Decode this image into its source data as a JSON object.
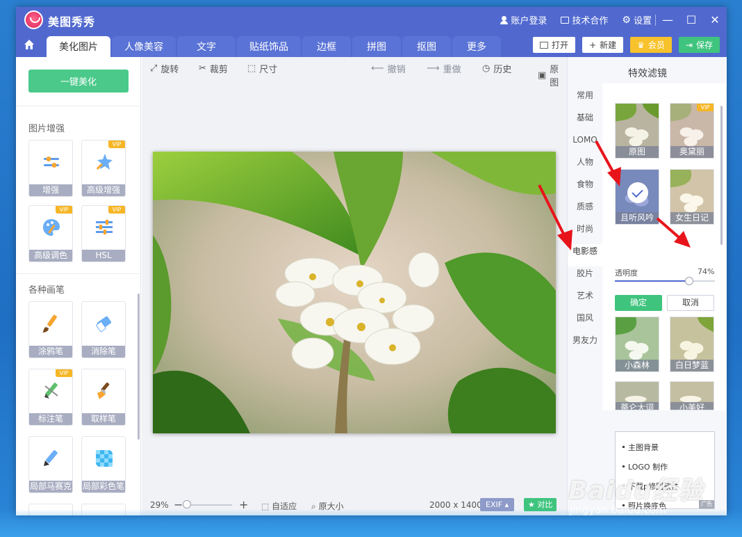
{
  "app": {
    "title": "美图秀秀",
    "account_login": "账户登录",
    "tech_coop": "技术合作",
    "settings": "设置"
  },
  "tabs": [
    {
      "label": "美化图片",
      "active": true
    },
    {
      "label": "人像美容"
    },
    {
      "label": "文字"
    },
    {
      "label": "贴纸饰品"
    },
    {
      "label": "边框"
    },
    {
      "label": "拼图"
    },
    {
      "label": "抠图"
    },
    {
      "label": "更多"
    }
  ],
  "top_buttons": {
    "open": "打开",
    "new": "新建",
    "vip": "会员",
    "save": "保存"
  },
  "left_panel": {
    "one_key": "一键美化",
    "section1_title": "图片增强",
    "section2_title": "各种画笔",
    "vip_badge": "VIP",
    "tools1": [
      {
        "label": "增强",
        "icon": "sliders-icon"
      },
      {
        "label": "高级增强",
        "icon": "magic-wand-icon"
      },
      {
        "label": "高级调色",
        "icon": "palette-icon"
      },
      {
        "label": "HSL",
        "icon": "hsl-sliders-icon"
      }
    ],
    "tools2": [
      {
        "label": "涂鸦笔",
        "icon": "brush-icon"
      },
      {
        "label": "消除笔",
        "icon": "eraser-icon"
      },
      {
        "label": "标注笔",
        "icon": "marker-icon"
      },
      {
        "label": "取样笔",
        "icon": "sample-brush-icon"
      },
      {
        "label": "局部马赛克",
        "icon": "mosaic-pen-icon"
      },
      {
        "label": "局部彩色笔",
        "icon": "color-pen-icon"
      }
    ]
  },
  "toolbar": {
    "rotate": "旋转",
    "crop": "裁剪",
    "size": "尺寸",
    "undo": "撤销",
    "redo": "重做",
    "history": "历史",
    "original": "原图"
  },
  "status": {
    "zoom": "29%",
    "fit": "自适应",
    "actual": "原大小",
    "dimensions": "2000 x 1400",
    "exif": "EXIF",
    "compare": "对比"
  },
  "right_panel": {
    "title": "特效滤镜",
    "categories": [
      "常用",
      "基础",
      "LOMO",
      "人物",
      "食物",
      "质感",
      "时尚",
      "电影感",
      "胶片",
      "艺术",
      "国风",
      "男友力"
    ],
    "active_category": "电影感",
    "filters": [
      {
        "label": "原图"
      },
      {
        "label": "奥黛丽",
        "vip": true
      },
      {
        "label": "且听风吟",
        "selected": true
      },
      {
        "label": "女生日记"
      },
      {
        "label": "小森林"
      },
      {
        "label": "白日梦蓝"
      },
      {
        "label": "蒂仑大词"
      },
      {
        "label": "小美好"
      }
    ],
    "opacity_label": "透明度",
    "opacity_value": "74%",
    "opacity_fraction": 0.74,
    "ok": "确定",
    "cancel": "取消",
    "ad_items": [
      "主图背景",
      "LOGO 制作",
      "下载p修图软件",
      "照片换底色"
    ],
    "ad_tag": "广告"
  },
  "watermark": {
    "text": "Baidu经验",
    "sub": "jingyan.baidu.com"
  },
  "colors": {
    "titlebar": "#5169cf",
    "accent_green": "#3fc47e",
    "vip_gold": "#f7c22b",
    "arrow_red": "#e8141b"
  }
}
